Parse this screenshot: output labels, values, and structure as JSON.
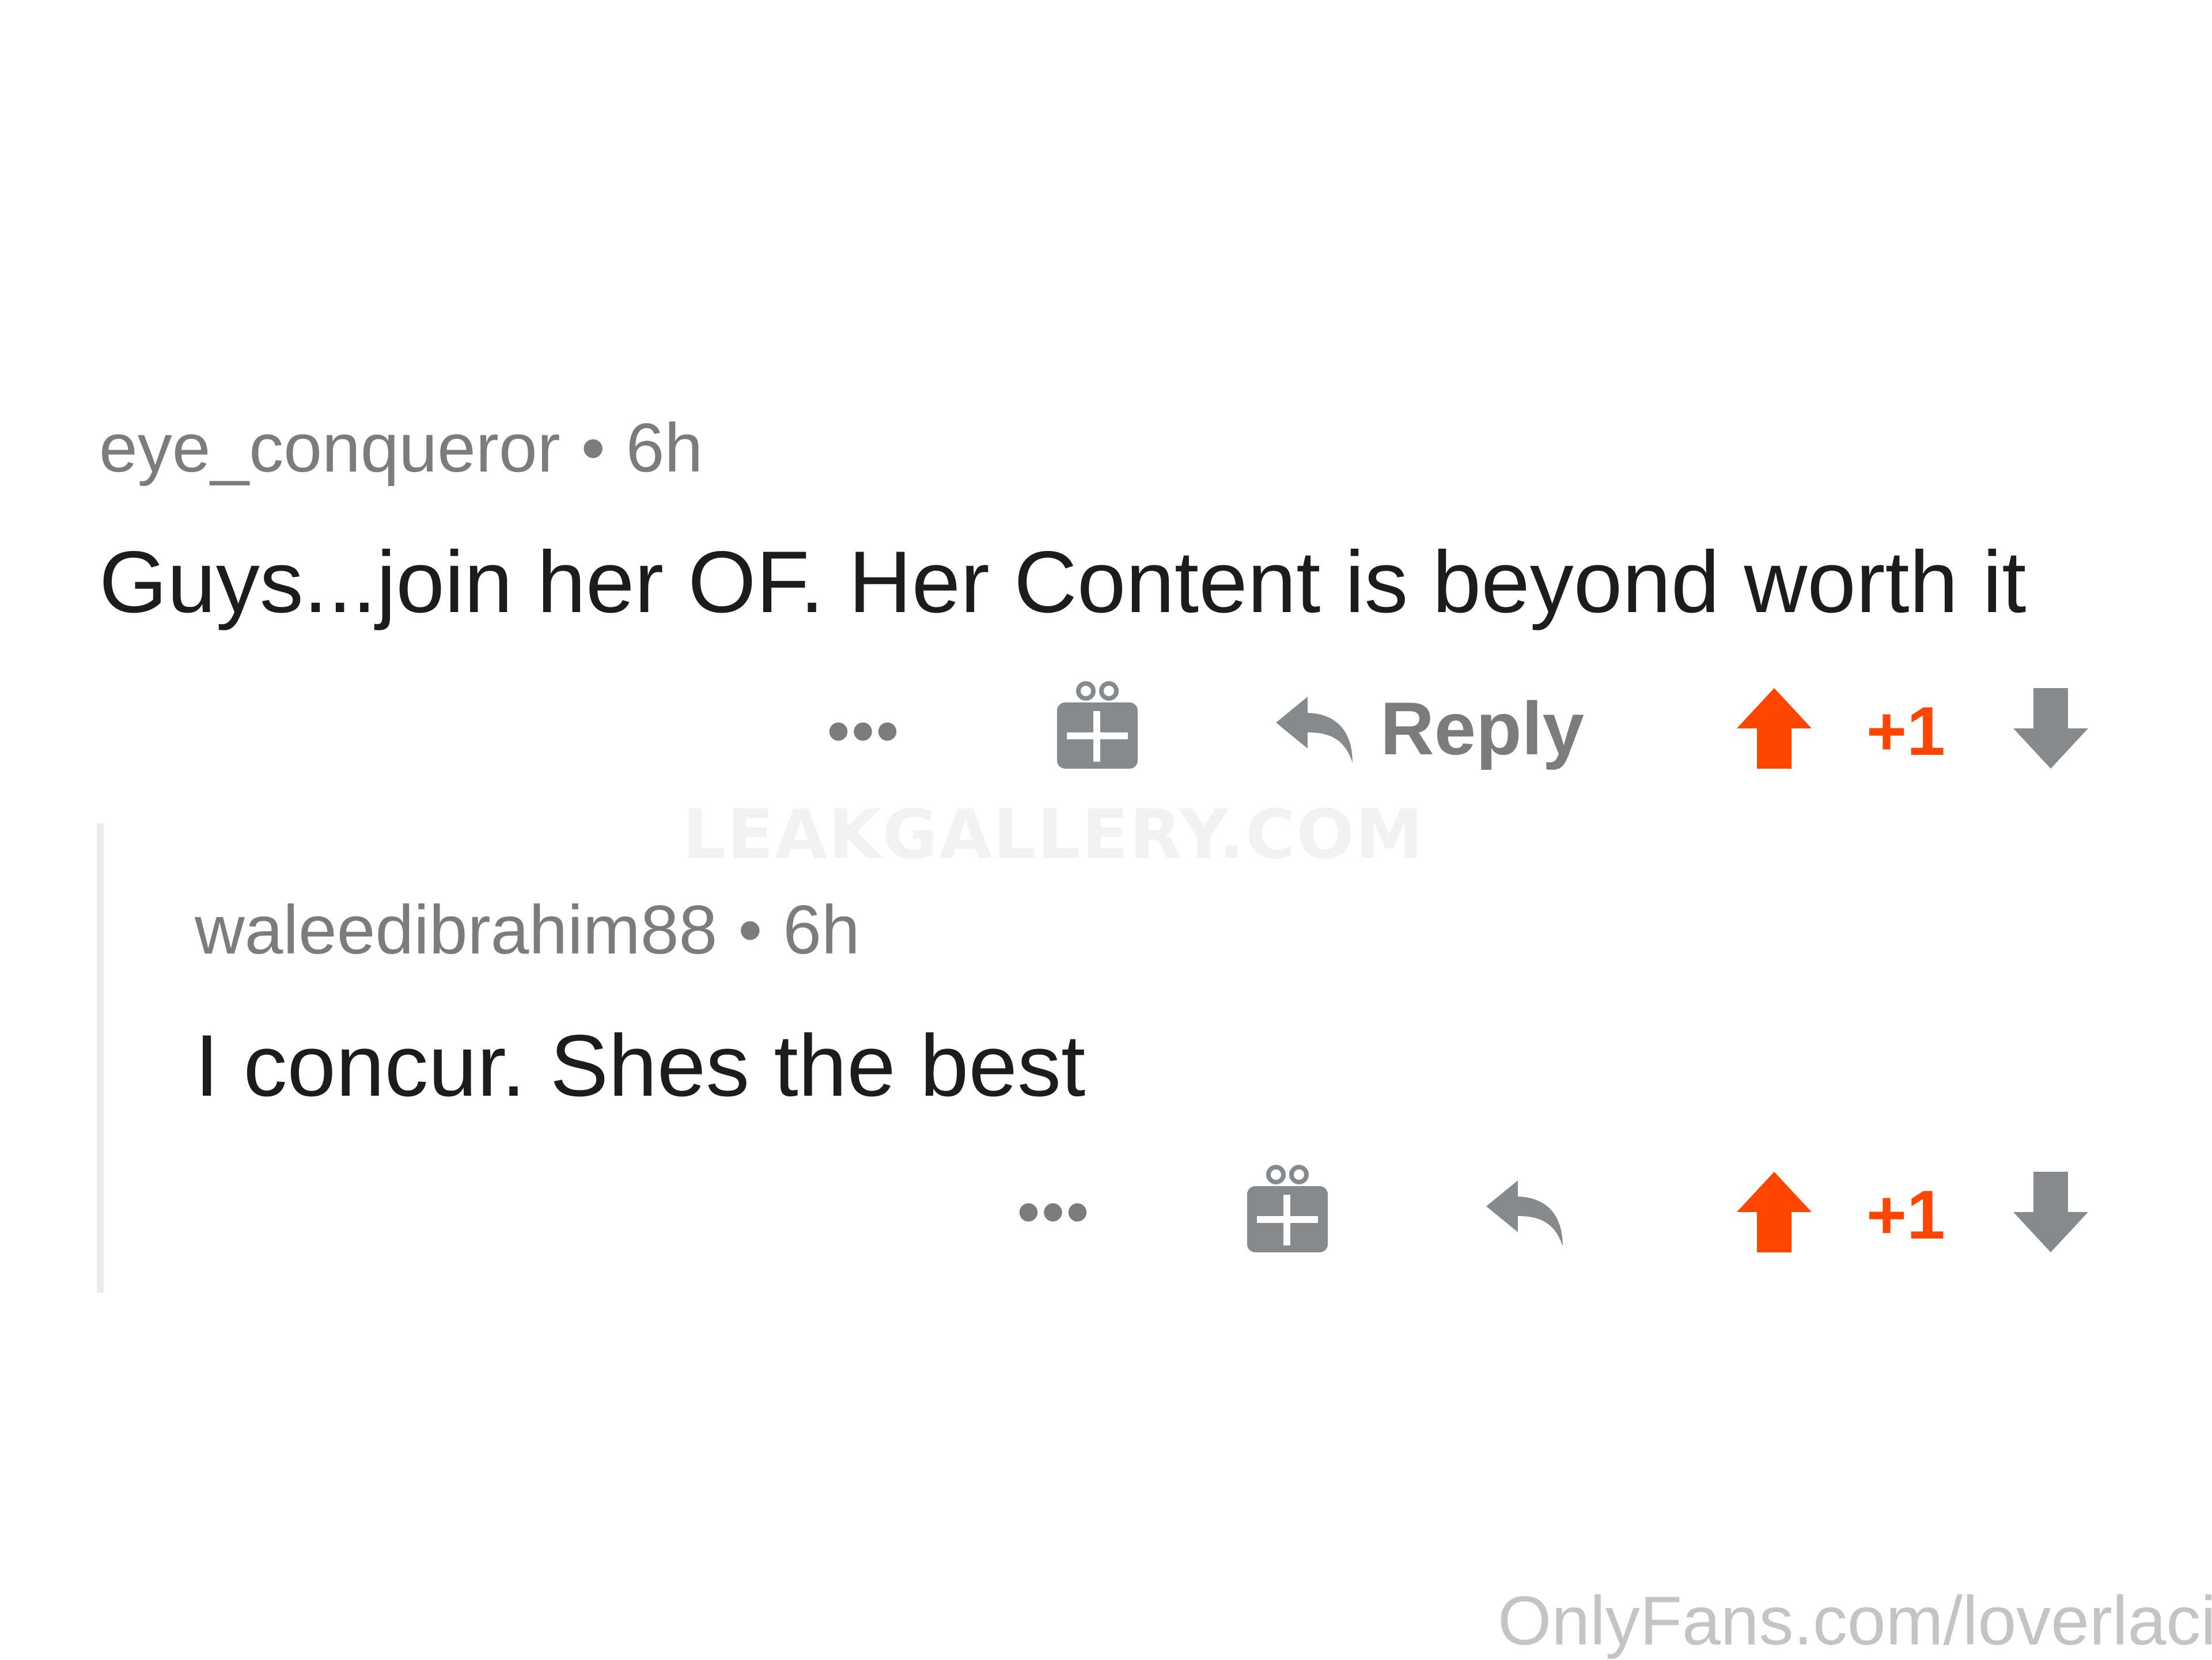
{
  "colors": {
    "meta_text": "#7c7c7c",
    "body_text": "#1c1c1c",
    "upvote_active": "#ff4500",
    "icon_gray": "#878a8c",
    "thread_line": "#ebebeb"
  },
  "comments": [
    {
      "username": "eye_conqueror",
      "separator": "•",
      "age": "6h",
      "text": "Guys...join her OF. Her Content is beyond worth it",
      "actions": {
        "more": "•••",
        "gift_icon": "gift-icon",
        "reply_icon": "reply-arrow-icon",
        "reply_label": "Reply",
        "upvote_icon": "upvote-arrow-icon",
        "score": "+1",
        "downvote_icon": "downvote-arrow-icon"
      }
    },
    {
      "username": "waleedibrahim88",
      "separator": "•",
      "age": "6h",
      "text": "I concur. Shes the best",
      "actions": {
        "more": "•••",
        "gift_icon": "gift-icon",
        "reply_icon": "reply-arrow-icon",
        "upvote_icon": "upvote-arrow-icon",
        "score": "+1",
        "downvote_icon": "downvote-arrow-icon"
      }
    }
  ],
  "watermarks": {
    "center": "LEAKGALLERY.COM",
    "corner": "OnlyFans.com/loverlaci"
  }
}
